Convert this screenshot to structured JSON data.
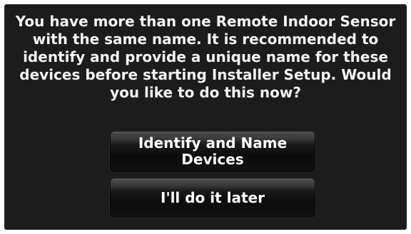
{
  "dialog": {
    "message": "You have more than one Remote Indoor Sensor with the same name. It is recommended to identify and provide a unique name for these devices before starting Installer Setup. Would you like to do this now?",
    "buttons": {
      "identify_label": "Identify and Name Devices",
      "later_label": "I'll do it later"
    }
  },
  "colors": {
    "screen_background": "#1c1c1c",
    "text": "#f4f4f4",
    "button_top": "#4d4d4d",
    "button_bottom": "#0c0c0c"
  }
}
